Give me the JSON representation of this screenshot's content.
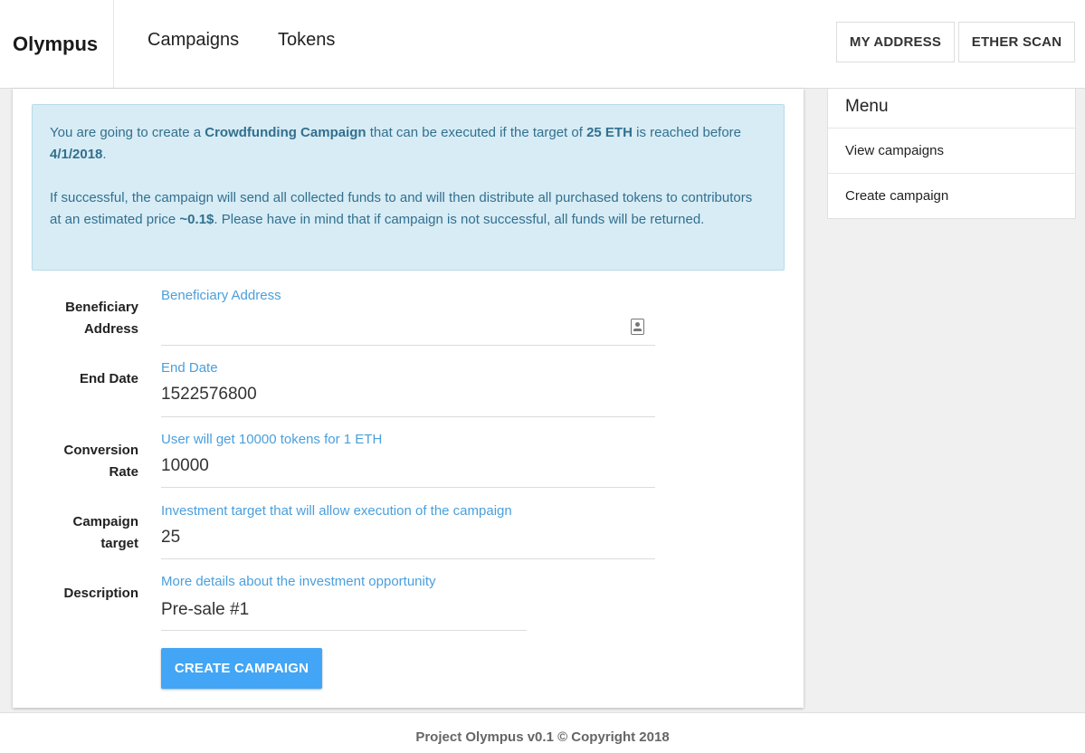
{
  "header": {
    "brand": "Olympus",
    "nav": {
      "campaigns": "Campaigns",
      "tokens": "Tokens"
    },
    "buttons": {
      "my_address": "MY ADDRESS",
      "ether_scan": "ETHER SCAN"
    }
  },
  "info": {
    "p1_a": "You are going to create a ",
    "p1_b": "Crowdfunding Campaign",
    "p1_c": " that can be executed if the target of ",
    "p1_d": "25 ETH",
    "p1_e": " is reached before ",
    "p1_f": "4/1/2018",
    "p1_g": ".",
    "p2_a": "If successful, the campaign will send all collected funds to and will then distribute all purchased tokens to contributors at an estimated price ",
    "p2_b": "~0.1$",
    "p2_c": ". Please have in mind that if campaign is not successful, all funds will be returned."
  },
  "form": {
    "beneficiary": {
      "label1": "Beneficiary",
      "label2": "Address",
      "hint": "Beneficiary Address",
      "value": "",
      "icon": "contact-book-icon"
    },
    "end_date": {
      "label": "End Date",
      "hint": "End Date",
      "value": "1522576800"
    },
    "conversion": {
      "label1": "Conversion",
      "label2": "Rate",
      "hint": "User will get 10000 tokens for 1 ETH",
      "value": "10000"
    },
    "target": {
      "label1": "Campaign",
      "label2": "target",
      "hint": "Investment target that will allow execution of the campaign",
      "value": "25"
    },
    "description": {
      "label": "Description",
      "hint": "More details about the investment opportunity",
      "value": "Pre-sale #1"
    },
    "submit": "CREATE CAMPAIGN"
  },
  "menu": {
    "title": "Menu",
    "items": [
      {
        "label": "View campaigns"
      },
      {
        "label": "Create campaign"
      }
    ]
  },
  "footer": {
    "text": "Project Olympus v0.1 © Copyright 2018"
  },
  "colors": {
    "accent": "#42a5f5",
    "hint": "#4a9fdc",
    "info_bg": "#d8ecf5",
    "info_text": "#31708f"
  }
}
